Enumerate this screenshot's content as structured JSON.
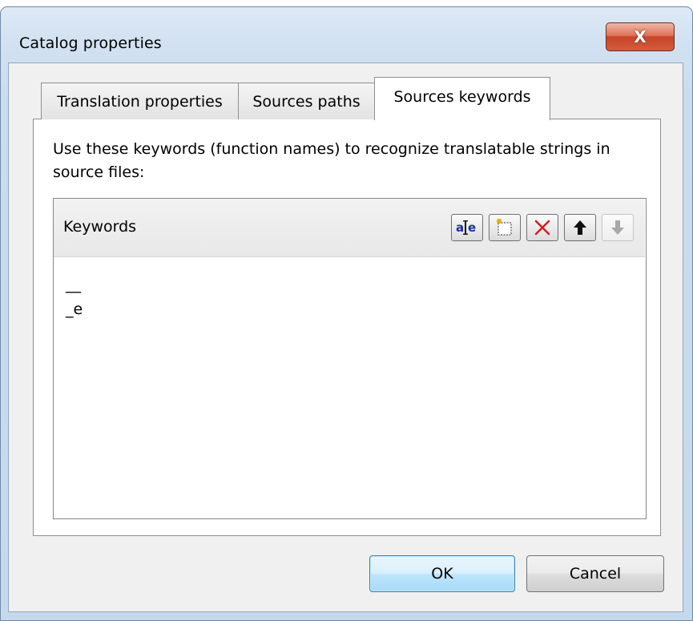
{
  "window": {
    "title": "Catalog properties",
    "close_glyph": "X"
  },
  "tabs": [
    {
      "label": "Translation properties",
      "active": false
    },
    {
      "label": "Sources paths",
      "active": false
    },
    {
      "label": "Sources keywords",
      "active": true
    }
  ],
  "content": {
    "description": "Use these keywords (function names) to recognize translatable strings in source files:"
  },
  "keywords": {
    "header": "Keywords",
    "toolbar": [
      {
        "name": "edit-item-icon",
        "enabled": true
      },
      {
        "name": "new-item-icon",
        "enabled": true
      },
      {
        "name": "delete-item-icon",
        "enabled": true
      },
      {
        "name": "move-up-icon",
        "enabled": true
      },
      {
        "name": "move-down-icon",
        "enabled": false
      }
    ],
    "items": [
      "__",
      "_e"
    ]
  },
  "buttons": {
    "ok": "OK",
    "cancel": "Cancel"
  },
  "colors": {
    "delete_red": "#d42020",
    "edit_blue": "#1a2fa0",
    "disabled_gray": "#a8a8a8"
  }
}
